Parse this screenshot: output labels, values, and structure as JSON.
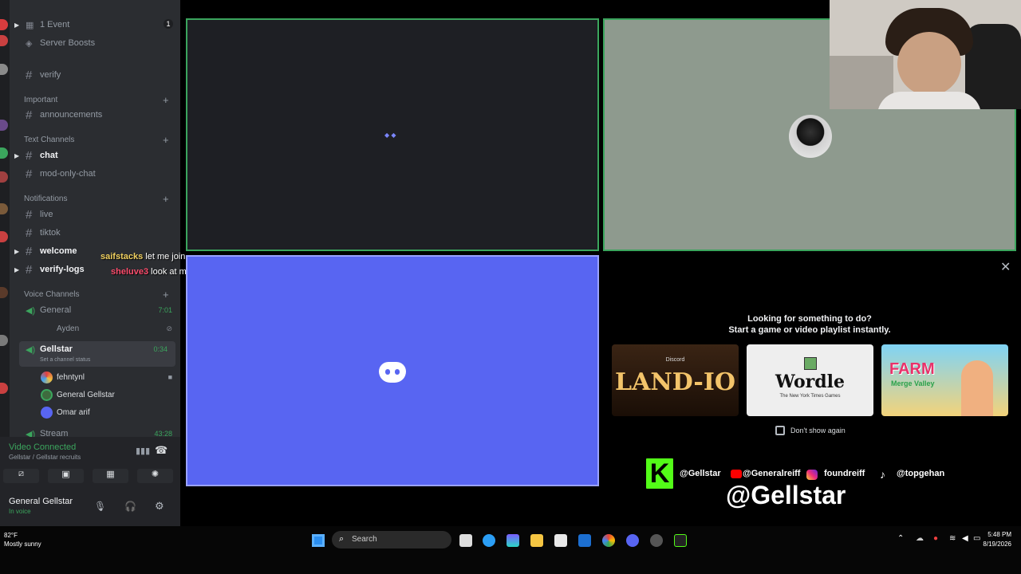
{
  "sidebar": {
    "top_items": [
      {
        "label": "1 Event",
        "badge": "1"
      },
      {
        "label": "Server Boosts"
      }
    ],
    "channels": {
      "verify": "verify",
      "important_cat": "Important",
      "announcements": "announcements",
      "text_cat": "Text Channels",
      "chat": "chat",
      "mod_only_chat": "mod-only-chat",
      "notifications_cat": "Notifications",
      "live": "live",
      "tiktok": "tiktok",
      "welcome": "welcome",
      "verify_logs": "verify-logs",
      "voice_cat": "Voice Channels"
    },
    "voice": {
      "general": {
        "label": "General",
        "timer": "7:01",
        "members": [
          "Ayden"
        ]
      },
      "gellstar": {
        "label": "Gellstar",
        "timer": "0:34",
        "status": "Set a channel status",
        "members": [
          "fehntynl",
          "General Gellstar",
          "Omar arif"
        ]
      },
      "stream": {
        "label": "Stream",
        "timer": "43:28"
      }
    }
  },
  "voice_panel": {
    "status": "Video Connected",
    "location": "Gellstar / Gellstar recruits",
    "user_name": "General Gellstar",
    "user_status": "In voice"
  },
  "stream_chat": [
    {
      "user": "saifstacks",
      "user_color": "#f0d060",
      "text": "let me join"
    },
    {
      "user": "sheluve3",
      "user_color": "#ff4d6d",
      "text": "look at my user and tell me who am I"
    }
  ],
  "activity": {
    "heading": "Looking for something to do?",
    "subheading": "Start a game or video playlist instantly.",
    "games": [
      {
        "name": "LAND-IO",
        "brand": "Discord"
      },
      {
        "name": "Wordle",
        "sub": "The New York Times Games"
      },
      {
        "name": "FARM",
        "sub": "Merge Valley"
      }
    ],
    "dont_show": "Don't show again"
  },
  "overlay": {
    "socials": [
      "@Gellstar",
      "@Generalreiff",
      "foundreiff",
      "@topgehan"
    ],
    "big_handle": "@Gellstar"
  },
  "taskbar": {
    "weather_temp": "82°F",
    "weather_desc": "Mostly sunny",
    "search_placeholder": "Search",
    "time": "5:48 PM",
    "date": "8/19/2026"
  }
}
